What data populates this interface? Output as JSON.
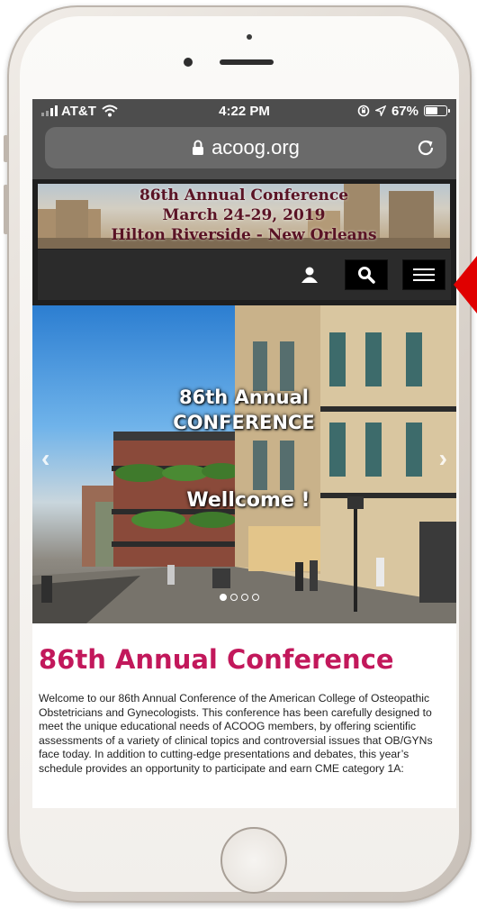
{
  "status_bar": {
    "carrier": "AT&T",
    "time": "4:22 PM",
    "battery": "67%",
    "battery_level": 0.67
  },
  "browser": {
    "url": "acoog.org"
  },
  "banner": {
    "line1": "86th Annual Conference",
    "line2": "March 24-29, 2019",
    "line3": "Hilton Riverside - New Orleans"
  },
  "hero": {
    "title_line1": "86th Annual",
    "title_line2": "CONFERENCE",
    "welcome": "Wellcome !",
    "prev_arrow": "‹",
    "next_arrow": "›",
    "slide_count": 4,
    "active_slide": 1
  },
  "content": {
    "heading": "86th Annual Conference",
    "paragraph": "Welcome to our 86th Annual Conference of the American College of Osteopathic Obstetricians and Gynecologists. This conference has been carefully designed to meet the unique educational needs of ACOOG members, by offering scientific assessments of a variety of clinical topics and controversial issues that OB/GYNs face today. In addition to cutting-edge presentations and debates, this year’s schedule provides an opportunity to participate and earn CME category 1A:"
  },
  "icons": {
    "user": "user-icon",
    "search": "search-icon",
    "menu": "hamburger-menu-icon",
    "lock": "lock-icon",
    "reload": "reload-icon",
    "wifi": "wifi-icon",
    "location": "location-arrow-icon",
    "rotation_lock": "rotation-lock-icon"
  },
  "colors": {
    "heading": "#c2185b",
    "banner_text": "#5a1325",
    "nav_bg": "#2b2b2b",
    "browser_chrome": "#4d4d4d",
    "annotation_arrow": "#e00000"
  }
}
